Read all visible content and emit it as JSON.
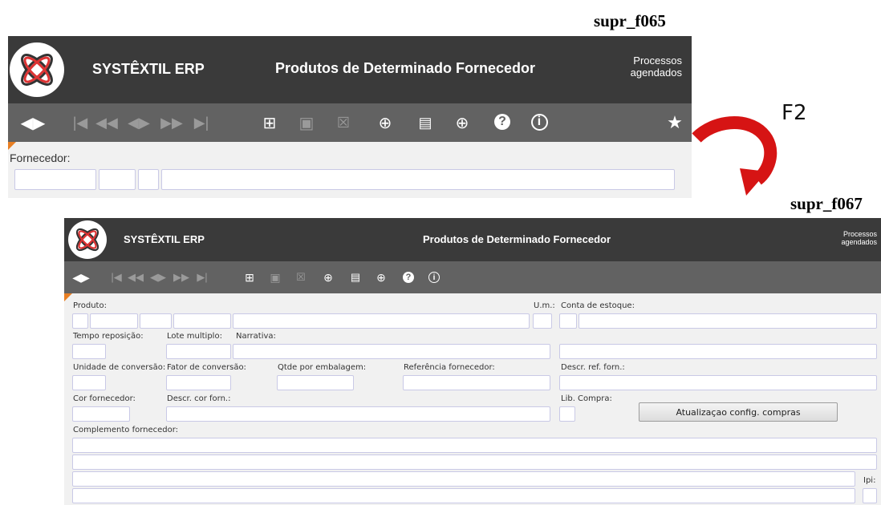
{
  "labels": {
    "top_code": "supr_f065",
    "bottom_code": "supr_f067",
    "shortcut": "F2"
  },
  "win1": {
    "brand": "SYSTÊXTIL ERP",
    "title": "Produtos de Determinado Fornecedor",
    "processes": "Processos agendados",
    "fields": {
      "fornecedor": "Fornecedor:"
    }
  },
  "win2": {
    "brand": "SYSTÊXTIL ERP",
    "title": "Produtos de Determinado Fornecedor",
    "processes": "Processos agendados",
    "fields": {
      "produto": "Produto:",
      "um": "U.m.:",
      "conta_estoque": "Conta de estoque:",
      "tempo_reposicao": "Tempo reposição:",
      "lote_multiplo": "Lote multiplo:",
      "narrativa": "Narrativa:",
      "unidade_conversao": "Unidade de conversão:",
      "fator_conversao": "Fator de conversão:",
      "qtde_embalagem": "Qtde por embalagem:",
      "referencia_fornecedor": "Referência fornecedor:",
      "descr_ref_forn": "Descr. ref. forn.:",
      "cor_fornecedor": "Cor fornecedor:",
      "descr_cor_forn": "Descr. cor forn.:",
      "lib_compra": "Lib. Compra:",
      "complemento_fornecedor": "Complemento fornecedor:",
      "ipi": "Ipi:"
    },
    "update_button": "Atualizaçao config. compras"
  },
  "icons": [
    "nav-back-forward-icon",
    "first-record-icon",
    "fast-back-icon",
    "prev-next-icon",
    "fast-forward-icon",
    "last-record-icon",
    "new-record-icon",
    "save-icon",
    "delete-icon",
    "add-icon",
    "query-icon",
    "zoom-icon",
    "help-icon",
    "info-icon",
    "favorite-star-icon"
  ],
  "colors": {
    "header": "#3a3a3a",
    "toolbar": "#626262",
    "form_bg": "#f1f1f1",
    "accent": "#e87f24",
    "arrow": "#e01010"
  }
}
